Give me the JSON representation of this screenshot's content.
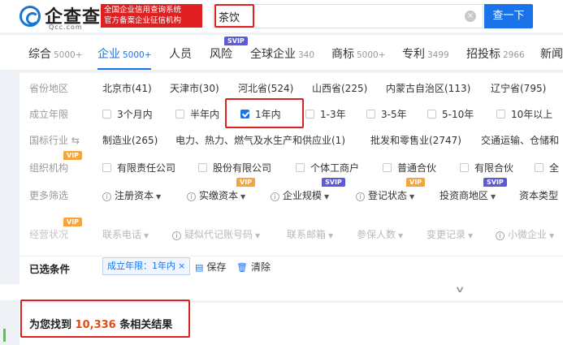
{
  "header": {
    "logo_text": "企查查",
    "logo_sub": "Qcc.com",
    "badge_line1": "全国企业信用查询系统",
    "badge_line2": "官方备案企业征信机构",
    "search_value": "茶饮",
    "clear_glyph": "×",
    "search_button": "查一下"
  },
  "tabs": [
    {
      "label": "综合",
      "count": "5000+"
    },
    {
      "label": "企业",
      "count": "5000+"
    },
    {
      "label": "人员",
      "count": ""
    },
    {
      "label": "风险",
      "count": "",
      "badge": "SVIP"
    },
    {
      "label": "全球企业",
      "count": "340"
    },
    {
      "label": "商标",
      "count": "5000+"
    },
    {
      "label": "专利",
      "count": "3499"
    },
    {
      "label": "招投标",
      "count": "2966"
    },
    {
      "label": "新闻",
      "count": ""
    }
  ],
  "filters": {
    "region": {
      "label": "省份地区",
      "options": [
        "北京市(41)",
        "天津市(30)",
        "河北省(524)",
        "山西省(225)",
        "内蒙古自治区(113)",
        "辽宁省(795)"
      ]
    },
    "years": {
      "label": "成立年限",
      "options": [
        "3个月内",
        "半年内",
        "1年内",
        "1-3年",
        "3-5年",
        "5-10年",
        "10年以上"
      ],
      "selected": "1年内"
    },
    "industry": {
      "label": "国标行业 ⇆",
      "options": [
        "制造业(265)",
        "电力、热力、燃气及水生产和供应业(1)",
        "批发和零售业(2747)",
        "交通运输、仓储和"
      ]
    },
    "org": {
      "label": "组织机构",
      "badge": "VIP",
      "options": [
        "有限责任公司",
        "股份有限公司",
        "个体工商户",
        "普通合伙",
        "有限合伙",
        "全"
      ]
    },
    "more": {
      "label": "更多筛选",
      "options": [
        "注册资本",
        "实缴资本",
        "企业规模",
        "登记状态",
        "投资商地区",
        "资本类型"
      ],
      "badges": [
        "",
        "VIP",
        "SVIP",
        "VIP",
        "SVIP",
        ""
      ]
    },
    "status": {
      "label": "经营状况",
      "badge": "VIP",
      "options": [
        "联系电话",
        "疑似代记账号码",
        "联系邮箱",
        "参保人数",
        "变更记录",
        "小微企业"
      ]
    }
  },
  "selected": {
    "label": "已选条件",
    "chip": "成立年限：1年内",
    "chip_close": "×",
    "save": "保存",
    "clear": "清除"
  },
  "result": {
    "prefix": "为您找到",
    "count": "10,336",
    "suffix": "条相关结果"
  },
  "colors": {
    "accent": "#1a73e8",
    "highlight": "#e02020",
    "svip": "#5b5bd6",
    "vip": "#f6a43e",
    "result_number": "#e04b18"
  }
}
